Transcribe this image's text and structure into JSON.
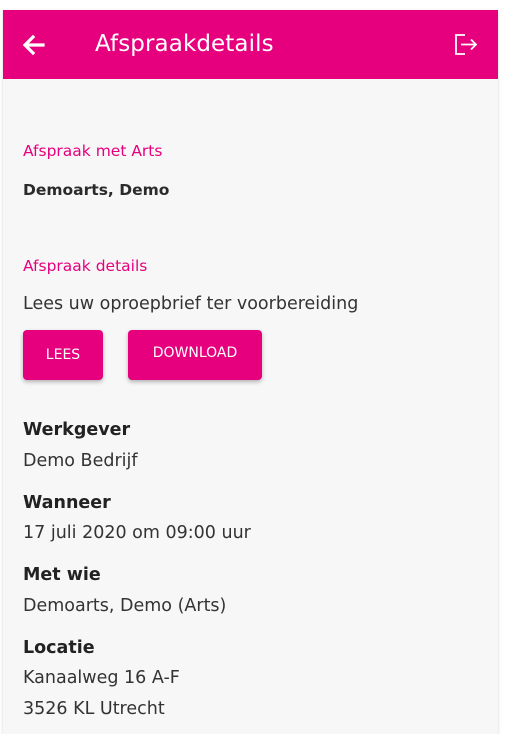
{
  "header": {
    "title": "Afspraakdetails",
    "back_icon": "arrow-left-icon",
    "logout_icon": "logout-icon"
  },
  "appointment": {
    "with_label": "Afspraak met Arts",
    "doctor_name": "Demoarts, Demo",
    "details_label": "Afspraak details",
    "instruction": "Lees uw oproepbrief ter voorbereiding",
    "read_button": "LEES",
    "download_button": "DOWNLOAD"
  },
  "info": {
    "employer_heading": "Werkgever",
    "employer_value": "Demo Bedrijf",
    "when_heading": "Wanneer",
    "when_value": "17 juli 2020 om 09:00 uur",
    "who_heading": "Met wie",
    "who_value": "Demoarts, Demo (Arts)",
    "location_heading": "Locatie",
    "location_line1": "Kanaalweg 16 A-F",
    "location_line2": "3526 KL Utrecht"
  },
  "colors": {
    "accent": "#e6007e",
    "background": "#f7f7f7",
    "text": "#2b2b2b"
  }
}
